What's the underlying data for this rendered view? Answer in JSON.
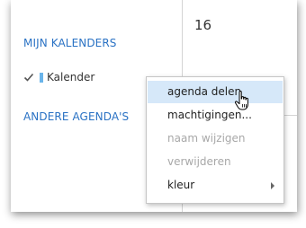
{
  "sidebar": {
    "my_calendars_heading": "MIJN KALENDERS",
    "calendar_item": {
      "label": "Kalender",
      "checked": true,
      "color": "#6ab4ea"
    },
    "other_calendars_heading": "ANDERE AGENDA'S"
  },
  "grid": {
    "day_number": "16"
  },
  "context_menu": {
    "items": [
      {
        "label": "agenda delen",
        "enabled": true,
        "highlighted": true
      },
      {
        "label": "machtigingen...",
        "enabled": true
      },
      {
        "label": "naam wijzigen",
        "enabled": false
      },
      {
        "label": "verwijderen",
        "enabled": false
      },
      {
        "label": "kleur",
        "enabled": true,
        "has_submenu": true
      }
    ]
  },
  "colors": {
    "accent": "#2a72c4",
    "menu_highlight": "#d6e8f9",
    "disabled_text": "#a8a8a8"
  },
  "icons": {
    "check": "check-icon",
    "submenu": "submenu-arrow-icon",
    "cursor": "hand-cursor-icon"
  }
}
